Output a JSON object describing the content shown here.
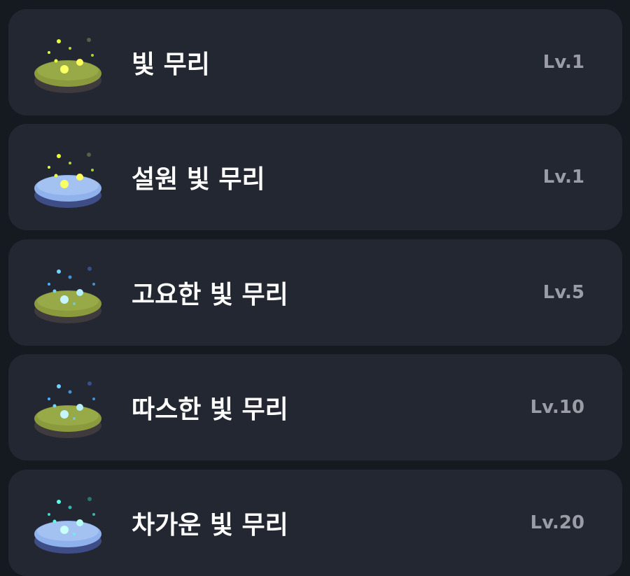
{
  "items": [
    {
      "name": "빛 무리",
      "level": "Lv.1",
      "icon": "firefly-swarm-icon",
      "ground": "grass",
      "light": "yellow"
    },
    {
      "name": "설원 빛 무리",
      "level": "Lv.1",
      "icon": "snowfield-firefly-swarm-icon",
      "ground": "snow",
      "light": "yellow"
    },
    {
      "name": "고요한 빛 무리",
      "level": "Lv.5",
      "icon": "calm-firefly-swarm-icon",
      "ground": "grass",
      "light": "blue"
    },
    {
      "name": "따스한 빛 무리",
      "level": "Lv.10",
      "icon": "warm-firefly-swarm-icon",
      "ground": "grass",
      "light": "blue"
    },
    {
      "name": "차가운 빛 무리",
      "level": "Lv.20",
      "icon": "cold-firefly-swarm-icon",
      "ground": "snow",
      "light": "cyan"
    }
  ],
  "colors": {
    "background": "#151a20",
    "card": "#232731",
    "title": "#ffffff",
    "level": "#9a9ca6",
    "grass": "#8b9a3c",
    "snow": "#8fb2ec",
    "light_yellow": "#e9ff3a",
    "light_blue": "#6fd2ff",
    "light_cyan": "#56ffe8"
  }
}
